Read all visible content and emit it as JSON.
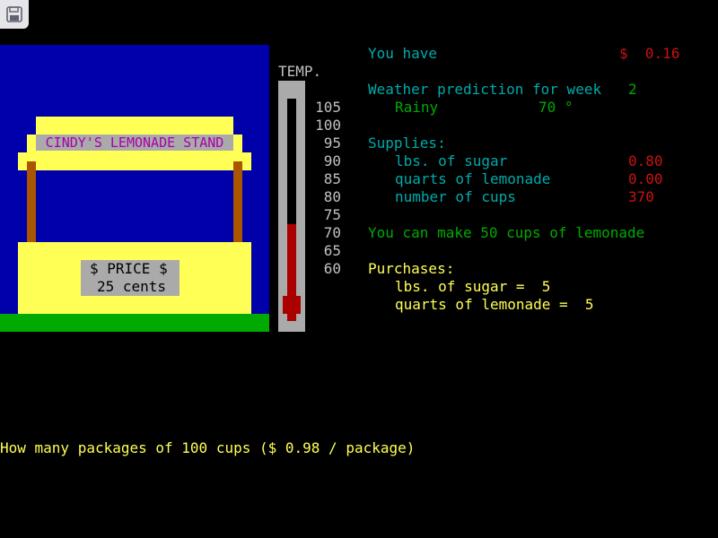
{
  "colors": {
    "sky": "#0000aa",
    "grass": "#00aa00",
    "stand": "#ffff55",
    "posts": "#aa5500",
    "sign_bg": "#aaaaaa",
    "sign_text": "#aa00aa",
    "mercury": "#aa0000",
    "label_cyan": "#00aaaa",
    "value_green": "#00aa00",
    "value_red": "#cc1111",
    "prompt_yellow": "#ffff55"
  },
  "toolbar": {
    "save_icon": "floppy-disk-icon",
    "side_toggle_icon": "chevron-right-icon",
    "side_toggle_glyph": "›"
  },
  "stand": {
    "sign": "CINDY'S LEMONADE STAND",
    "price_title": "$ PRICE $",
    "price_value": "25 cents"
  },
  "thermometer": {
    "label": "TEMP.",
    "ticks": [
      "105",
      "100",
      "95",
      "90",
      "85",
      "80",
      "75",
      "70",
      "65",
      "60"
    ],
    "level": 70
  },
  "status": {
    "cash_label": "You have",
    "cash_value": "$  0.16",
    "weather_label": "Weather prediction for week",
    "week": "2",
    "condition": "Rainy",
    "temperature": "70 °",
    "supplies_label": "Supplies:",
    "supplies": [
      {
        "label": "lbs. of sugar",
        "value": "0.80"
      },
      {
        "label": "quarts of lemonade",
        "value": "0.00"
      },
      {
        "label": "number of cups",
        "value": "370"
      }
    ],
    "can_make": "You can make 50 cups of lemonade",
    "purchases_label": "Purchases:",
    "purchases": [
      {
        "text": "lbs. of sugar =  5"
      },
      {
        "text": "quarts of lemonade =  5"
      }
    ]
  },
  "prompt": {
    "text": "How many packages of 100 cups ($ 0.98 / package)"
  }
}
